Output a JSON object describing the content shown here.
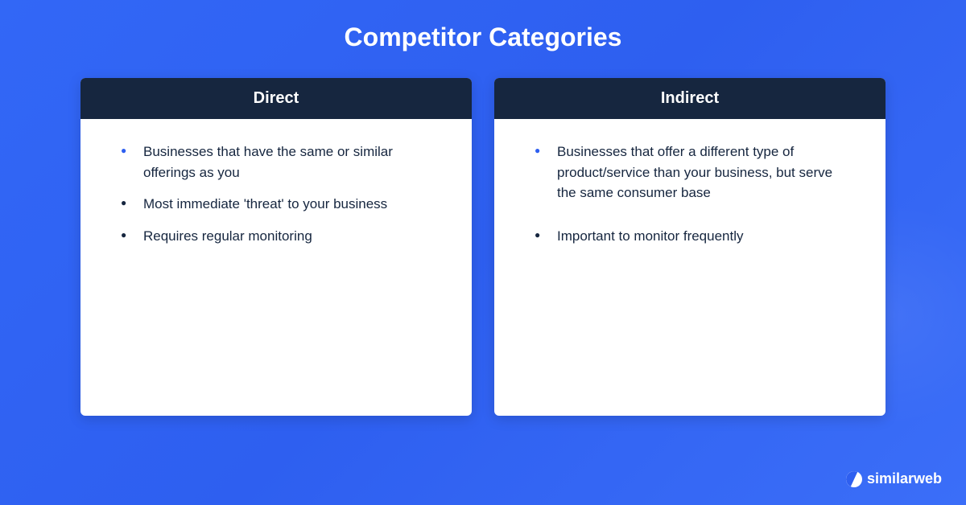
{
  "title": "Competitor Categories",
  "cards": [
    {
      "header": "Direct",
      "bullets": [
        "Businesses that have the same or similar offerings as you",
        "Most immediate 'threat' to your business",
        "Requires regular monitoring"
      ]
    },
    {
      "header": "Indirect",
      "bullets": [
        "Businesses that offer a different type of product/service than your business, but serve the same consumer base",
        "Important to monitor frequently"
      ]
    }
  ],
  "brand": "similarweb"
}
